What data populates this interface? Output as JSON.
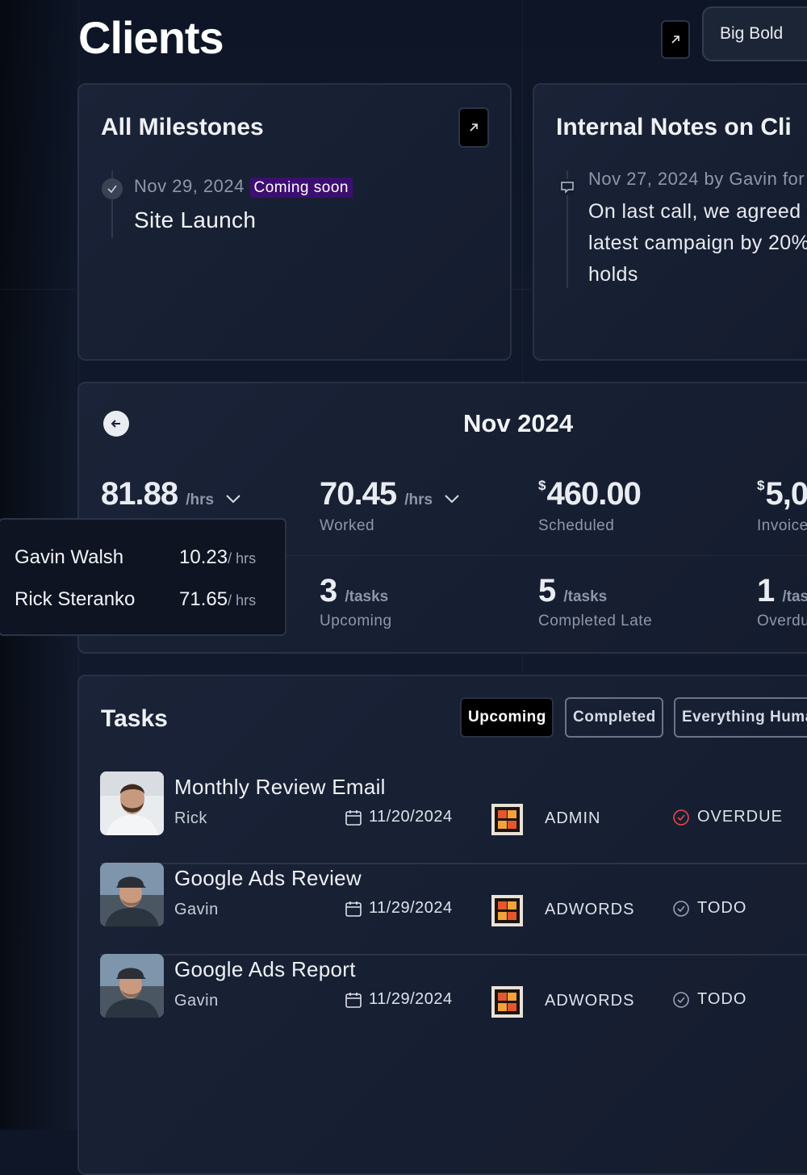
{
  "header": {
    "title": "Clients",
    "client_name": "Big Bold",
    "open_icon": "arrow-up-right-icon"
  },
  "milestones": {
    "title": "All Milestones",
    "items": [
      {
        "date": "Nov 29, 2024",
        "badge": "Coming soon",
        "name": "Site Launch"
      }
    ]
  },
  "notes": {
    "title": "Internal Notes on Cli",
    "items": [
      {
        "meta": "Nov 27, 2024 by Gavin for",
        "lines": [
          "On last call, we agreed",
          "latest campaign by 20%",
          "holds"
        ]
      }
    ]
  },
  "stats": {
    "month": "Nov 2024",
    "hours_total": {
      "value": "81.88",
      "unit": "/hrs"
    },
    "hours_worked": {
      "value": "70.45",
      "unit": "/hrs",
      "label": "Worked"
    },
    "scheduled": {
      "currency": "$",
      "value": "460.00",
      "label": "Scheduled"
    },
    "invoiced": {
      "currency": "$",
      "value": "5,0",
      "label": "Invoice"
    },
    "upcoming": {
      "value": "3",
      "unit": "/tasks",
      "label": "Upcoming"
    },
    "completed_late": {
      "value": "5",
      "unit": "/tasks",
      "label": "Completed Late"
    },
    "overdue": {
      "value": "1",
      "unit": "/task",
      "label": "Overdu"
    }
  },
  "hours_breakdown": [
    {
      "name": "Gavin Walsh",
      "hours": "10.23",
      "unit": "/ hrs"
    },
    {
      "name": "Rick Steranko",
      "hours": "71.65",
      "unit": "/ hrs"
    }
  ],
  "tasks": {
    "title": "Tasks",
    "tabs": [
      {
        "label": "Upcoming",
        "active": true
      },
      {
        "label": "Completed",
        "active": false
      },
      {
        "label": "Everything Huma",
        "active": false
      }
    ],
    "rows": [
      {
        "title": "Monthly Review Email",
        "owner": "Rick",
        "date": "11/20/2024",
        "category": "ADMIN",
        "status": "OVERDUE"
      },
      {
        "title": "Google Ads Review",
        "owner": "Gavin",
        "date": "11/29/2024",
        "category": "ADWORDS",
        "status": "TODO"
      },
      {
        "title": "Google Ads Report",
        "owner": "Gavin",
        "date": "11/29/2024",
        "category": "ADWORDS",
        "status": "TODO"
      }
    ]
  },
  "colors": {
    "background": "#0f1628",
    "card": "#161e31",
    "badge": "#3d0e72",
    "overdue": "#e5484d"
  }
}
